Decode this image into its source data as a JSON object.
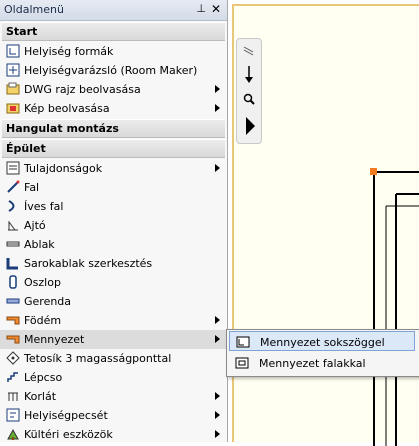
{
  "panel": {
    "title": "Oldalmenü",
    "pin_icon": "pin-icon",
    "close_icon": "close-icon"
  },
  "sections": {
    "start": "Start",
    "hangulat": "Hangulat montázs",
    "epulet": "Épület"
  },
  "start_items": [
    {
      "label": "Helyiség formák",
      "icon": "room-shape-icon",
      "submenu": false
    },
    {
      "label": "Helyiségvarázsló (Room Maker)",
      "icon": "room-maker-icon",
      "submenu": false
    },
    {
      "label": "DWG rajz beolvasása",
      "icon": "dwg-import-icon",
      "submenu": true
    },
    {
      "label": "Kép beolvasása",
      "icon": "image-import-icon",
      "submenu": true
    }
  ],
  "epulet_items": [
    {
      "label": "Tulajdonságok",
      "icon": "properties-icon",
      "submenu": true
    },
    {
      "label": "Fal",
      "icon": "wall-icon",
      "submenu": false
    },
    {
      "label": "Íves fal",
      "icon": "curved-wall-icon",
      "submenu": false
    },
    {
      "label": "Ajtó",
      "icon": "door-icon",
      "submenu": false
    },
    {
      "label": "Ablak",
      "icon": "window-icon",
      "submenu": false
    },
    {
      "label": "Sarokablak szerkesztés",
      "icon": "corner-window-icon",
      "submenu": false
    },
    {
      "label": "Oszlop",
      "icon": "column-icon",
      "submenu": false
    },
    {
      "label": "Gerenda",
      "icon": "beam-icon",
      "submenu": false
    },
    {
      "label": "Födém",
      "icon": "slab-icon",
      "submenu": true
    },
    {
      "label": "Mennyezet",
      "icon": "ceiling-icon",
      "submenu": true
    },
    {
      "label": "Tetosík 3 magasságponttal",
      "icon": "roof-plane-icon",
      "submenu": false
    },
    {
      "label": "Lépcso",
      "icon": "stairs-icon",
      "submenu": false
    },
    {
      "label": "Korlát",
      "icon": "railing-icon",
      "submenu": true
    },
    {
      "label": "Helyiségpecsét",
      "icon": "room-stamp-icon",
      "submenu": true
    },
    {
      "label": "Kültéri eszközök",
      "icon": "outdoor-tools-icon",
      "submenu": true
    }
  ],
  "submenu": {
    "items": [
      {
        "label": "Mennyezet sokszöggel",
        "icon": "polygon-ceiling-icon"
      },
      {
        "label": "Mennyezet falakkal",
        "icon": "wall-ceiling-icon"
      }
    ]
  }
}
